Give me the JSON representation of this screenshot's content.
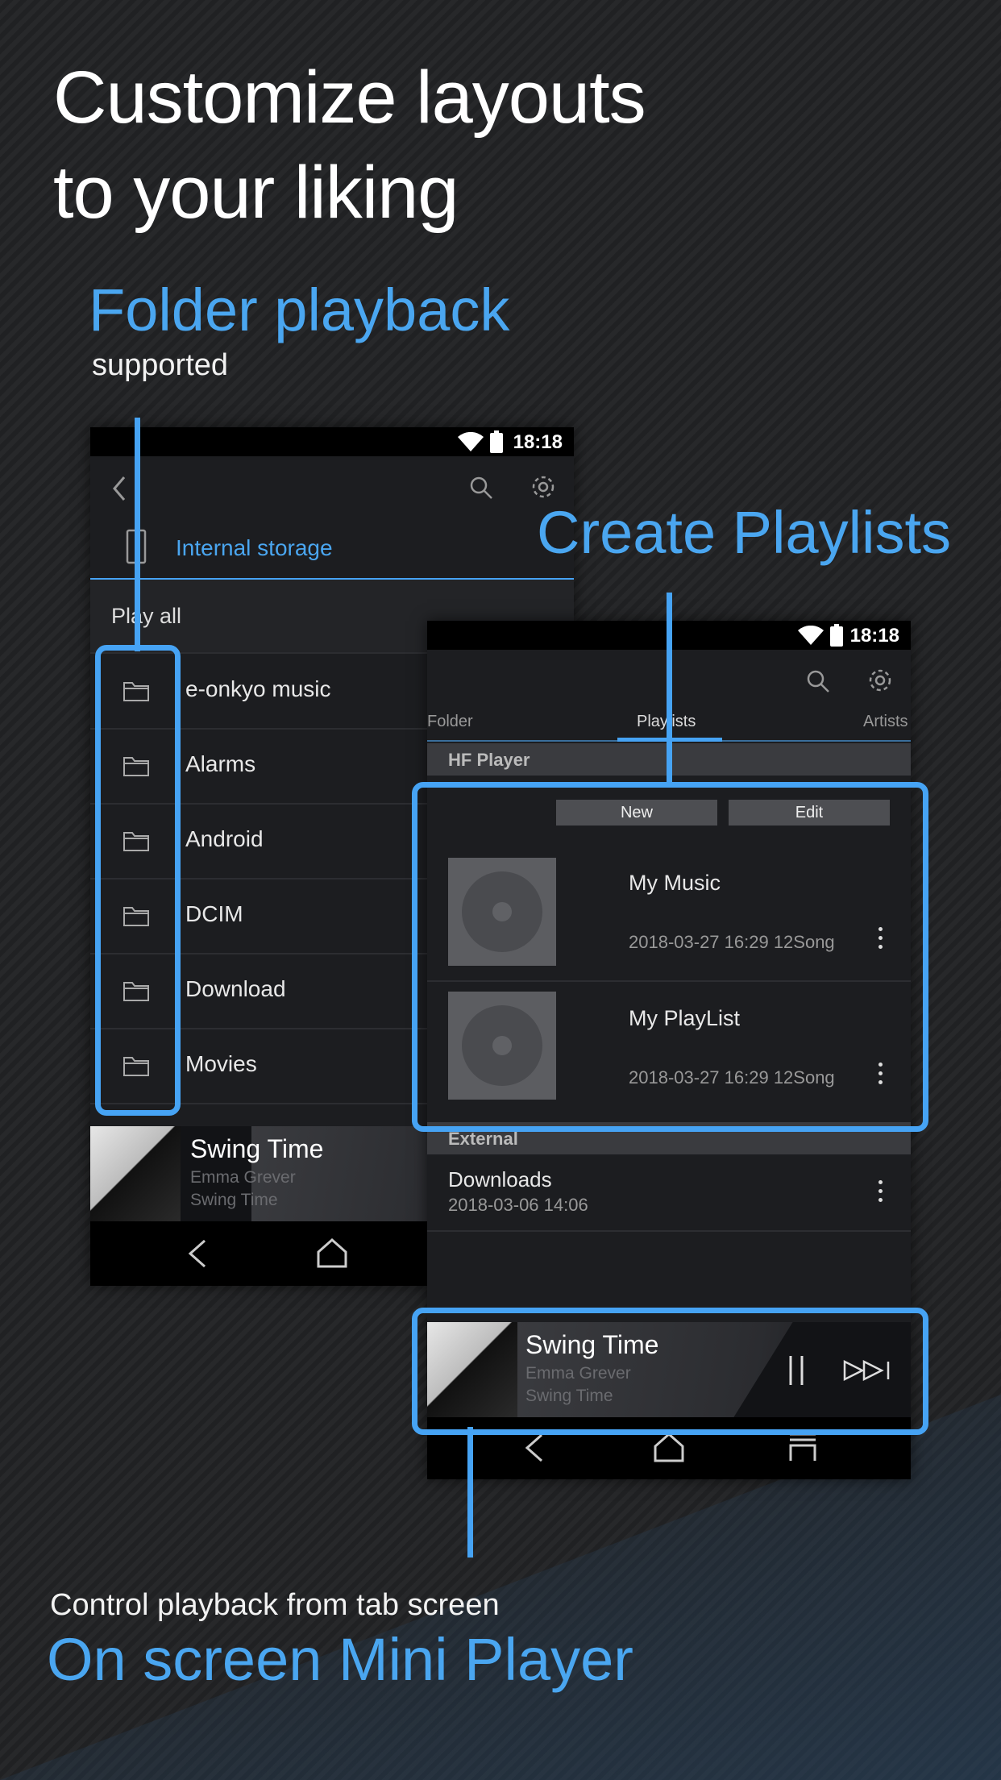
{
  "headline": {
    "line1": "Customize layouts",
    "line2": "to your liking"
  },
  "folder_callout": {
    "title": "Folder playback",
    "subtitle": "supported"
  },
  "playlist_callout": {
    "title": "Create Playlists"
  },
  "mini_callout": {
    "subtitle": "Control playback from tab screen",
    "title": "On screen Mini Player"
  },
  "colors": {
    "accent": "#46a3f4",
    "bg": "#222325",
    "phone_bg": "#1c1d20"
  },
  "phone1": {
    "status_time": "18:18",
    "storage_label": "Internal storage",
    "play_all": "Play all",
    "folders": [
      "e-onkyo music",
      "Alarms",
      "Android",
      "DCIM",
      "Download",
      "Movies"
    ],
    "mini": {
      "title": "Swing Time",
      "artist": "Emma Grever",
      "album": "Swing Time"
    }
  },
  "phone2": {
    "status_time": "18:18",
    "tabs": [
      "Folder",
      "Playlists",
      "Artists"
    ],
    "section_hf": "HF Player",
    "new_label": "New",
    "edit_label": "Edit",
    "playlists": [
      {
        "name": "My Music",
        "meta": "2018-03-27 16:29 12Song"
      },
      {
        "name": "My PlayList",
        "meta": "2018-03-27 16:29 12Song"
      }
    ],
    "section_ext": "External",
    "external": {
      "name": "Downloads",
      "meta": "2018-03-06 14:06"
    },
    "mini": {
      "title": "Swing Time",
      "artist": "Emma Grever",
      "album": "Swing Time"
    }
  },
  "icons": [
    "wifi-icon",
    "battery-icon",
    "back-icon",
    "search-icon",
    "gear-icon",
    "phone-storage-icon",
    "folder-icon",
    "pause-icon",
    "skip-next-icon",
    "nav-back-icon",
    "nav-home-icon",
    "nav-recents-icon",
    "kebab-menu-icon"
  ]
}
